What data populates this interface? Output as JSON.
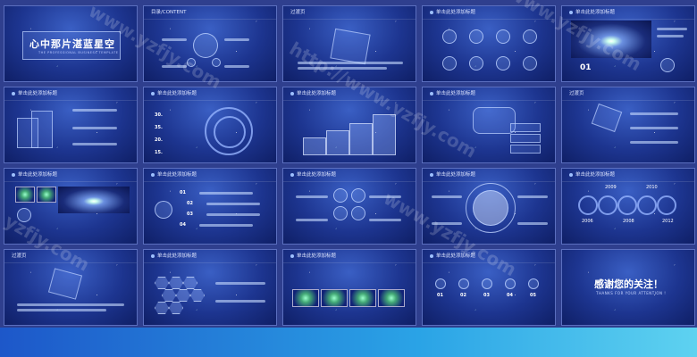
{
  "slides": [
    {
      "title": "心中那片湛蓝星空",
      "subtitle": "THE PROFESSIONAL BUSINESS TEMPLATE"
    },
    {
      "title": "目录/CONTENT"
    },
    {
      "title": "过渡页"
    },
    {
      "title": "单击此处添加标题"
    },
    {
      "title": "单击此处添加标题",
      "number": "01"
    },
    {
      "title": "单击此处添加标题"
    },
    {
      "title": "单击此处添加标题",
      "values": [
        "30.",
        "35.",
        "20.",
        "15."
      ]
    },
    {
      "title": "单击此处添加标题"
    },
    {
      "title": "单击此处添加标题"
    },
    {
      "title": "过渡页"
    },
    {
      "title": "单击此处添加标题"
    },
    {
      "title": "单击此处添加标题",
      "items": [
        "01",
        "02",
        "03",
        "04"
      ]
    },
    {
      "title": "单击此处添加标题"
    },
    {
      "title": "单击此处添加标题"
    },
    {
      "title": "单击此处添加标题",
      "years": [
        "2009",
        "2010",
        "2006",
        "2008",
        "2012"
      ]
    },
    {
      "title": "过渡页"
    },
    {
      "title": "单击此处添加标题"
    },
    {
      "title": "单击此处添加标题"
    },
    {
      "title": "单击此处添加标题",
      "items": [
        "01",
        "02",
        "03",
        "04",
        "05"
      ]
    },
    {
      "thanks": "感谢您的关注！",
      "thanks_en": "THANKS FOR YOUR ATTENTION !"
    }
  ],
  "watermarks": [
    "www.yzfjy.com",
    "http://www.yzfjy.com",
    "yzfjy.com"
  ]
}
